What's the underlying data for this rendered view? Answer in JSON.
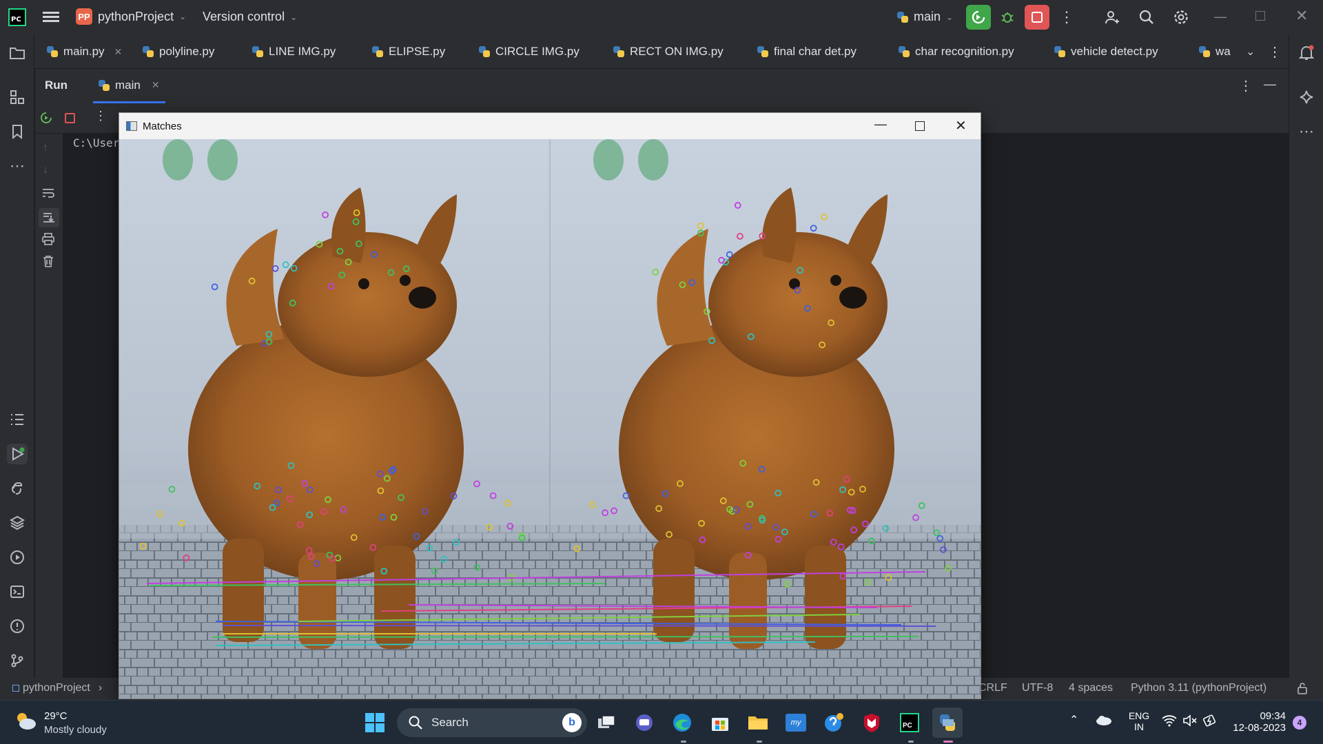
{
  "titlebar": {
    "project_badge": "PP",
    "project_name": "pythonProject",
    "version_control": "Version control",
    "branch": "main"
  },
  "tabs": [
    {
      "label": "main.py"
    },
    {
      "label": "polyline.py"
    },
    {
      "label": "LINE IMG.py"
    },
    {
      "label": "ELIPSE.py"
    },
    {
      "label": "CIRCLE IMG.py"
    },
    {
      "label": "RECT ON IMG.py"
    },
    {
      "label": "final char det.py"
    },
    {
      "label": "char recognition.py"
    },
    {
      "label": "vehicle detect.py"
    },
    {
      "label": "wa"
    }
  ],
  "run_panel": {
    "run_label": "Run",
    "config_tab": "main",
    "console_text": "C:\\User"
  },
  "matches_window": {
    "title": "Matches"
  },
  "statusbar": {
    "project": "pythonProject",
    "line_ending": "CRLF",
    "encoding": "UTF-8",
    "indent": "4 spaces",
    "interpreter": "Python 3.11 (pythonProject)"
  },
  "taskbar": {
    "weather_temp": "29°C",
    "weather_desc": "Mostly cloudy",
    "search_label": "Search",
    "lang_top": "ENG",
    "lang_bottom": "IN",
    "time": "09:34",
    "date": "12-08-2023",
    "notification_count": "4"
  },
  "colors": {
    "ide_bg": "#1e1f22",
    "panel_bg": "#2b2d30",
    "run_active": "#3fa64a",
    "stop_red": "#e05555",
    "project_badge": "#e8664a"
  }
}
